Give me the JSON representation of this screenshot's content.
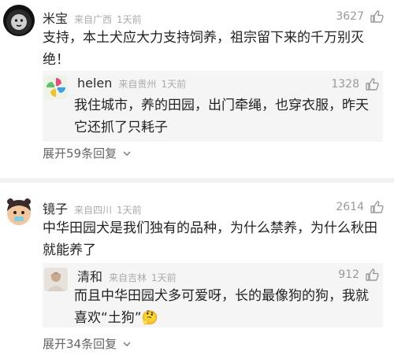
{
  "comments": [
    {
      "user": "米宝",
      "location": "来自广西",
      "time": "1天前",
      "likes": "3627",
      "text": "支持，本土犬应大力支持饲养，祖宗留下来的千万别灭绝！",
      "reply": {
        "user": "helen",
        "location": "来自贵州",
        "time": "1天前",
        "likes": "1328",
        "text": "我住城市，养的田园，出门牵绳，也穿衣服，昨天它还抓了只耗子"
      },
      "expand_label": "展开59条回复"
    },
    {
      "user": "镜子",
      "location": "来自四川",
      "time": "1天前",
      "likes": "2614",
      "text": "中华田园犬是我们独有的品种，为什么禁养，为什么秋田就能养了",
      "reply": {
        "user": "清和",
        "location": "来自吉林",
        "time": "1天前",
        "likes": "912",
        "text": "而且中华田园犬多可爱呀，长的最像狗的狗，我就喜欢“土狗”🤔"
      },
      "expand_label": "展开34条回复"
    }
  ],
  "colors": {
    "like_icon": "#9a9a9a",
    "username": "#2a2a2a",
    "meta": "#aaaaaa"
  }
}
